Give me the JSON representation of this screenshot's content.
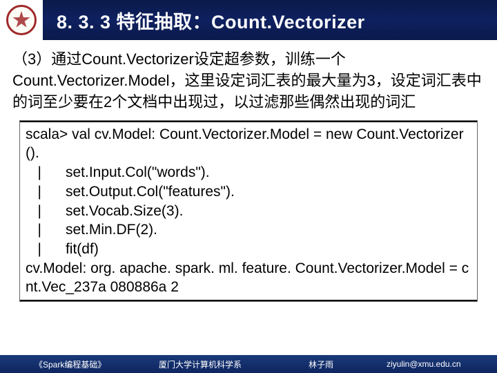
{
  "header": {
    "title": "8. 3. 3 特征抽取：Count.Vectorizer"
  },
  "body": {
    "paragraph": "（3）通过Count.Vectorizer设定超参数，训练一个Count.Vectorizer.Model，这里设定词汇表的最大量为3，设定词汇表中的词至少要在2个文档中出现过，以过滤那些偶然出现的词汇"
  },
  "code": {
    "lines": "scala> val cv.Model: Count.Vectorizer.Model = new Count.Vectorizer().\n   |      set.Input.Col(\"words\").\n   |      set.Output.Col(\"features\").\n   |      set.Vocab.Size(3).\n   |      set.Min.DF(2).\n   |      fit(df)\ncv.Model: org. apache. spark. ml. feature. Count.Vectorizer.Model = cnt.Vec_237a 080886a 2"
  },
  "footer": {
    "book": "《Spark编程基础》",
    "dept": "厦门大学计算机科学系",
    "author": "林子雨",
    "email": "ziyulin@xmu.edu.cn"
  }
}
